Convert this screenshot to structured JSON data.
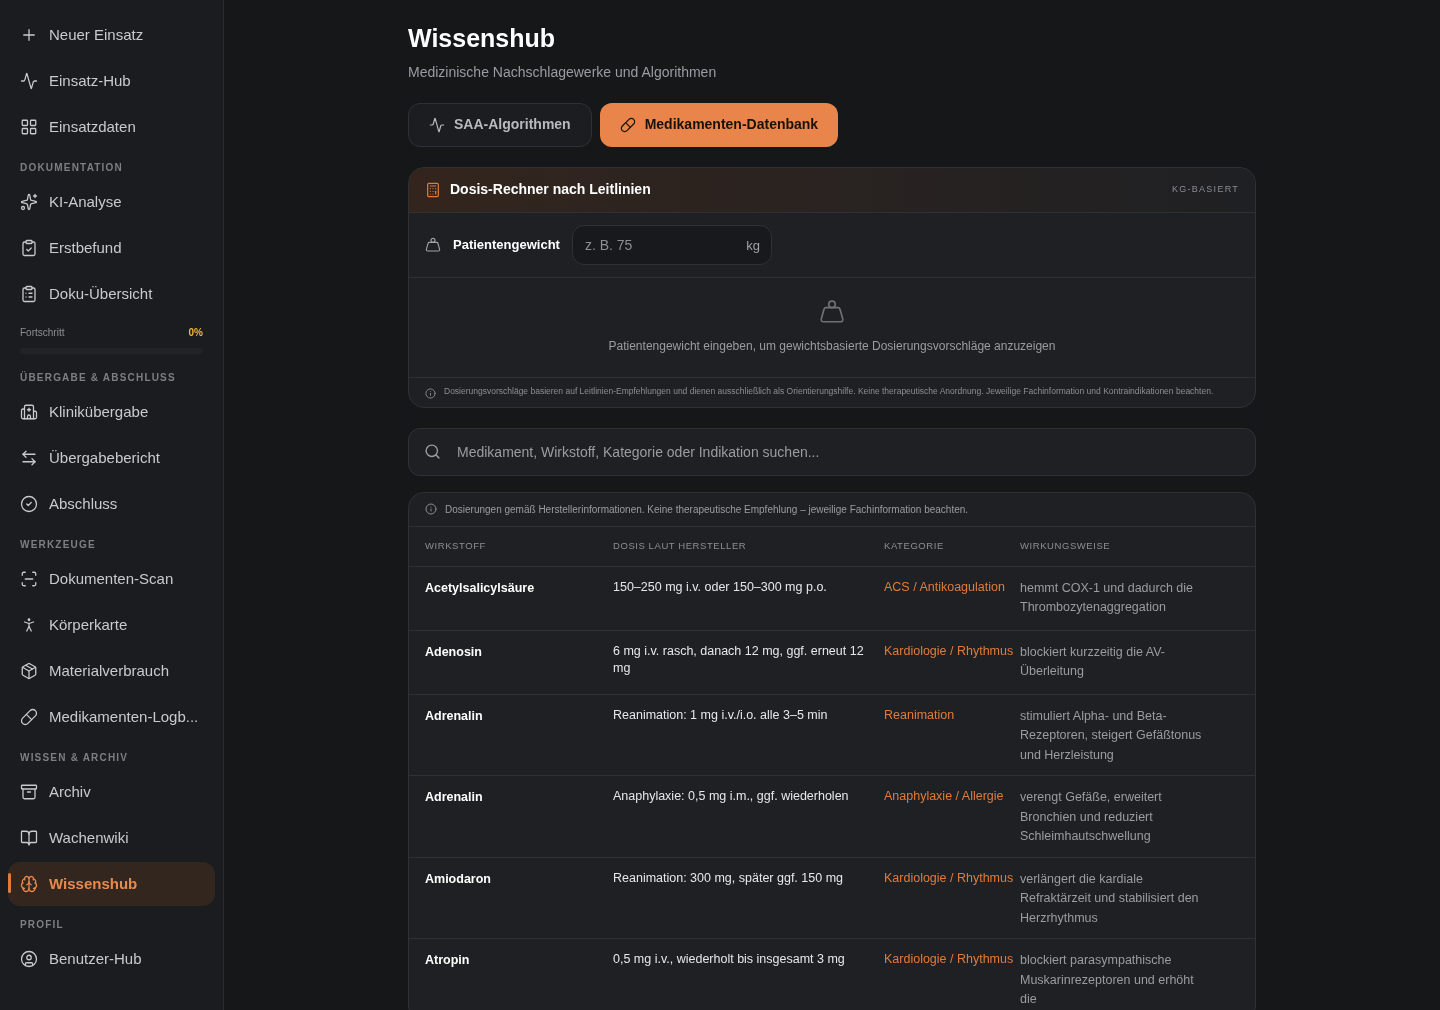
{
  "sidebar": {
    "sections": [
      {
        "items": [
          {
            "label": "Neuer Einsatz",
            "selected": false
          },
          {
            "label": "Einsatz-Hub",
            "selected": false
          },
          {
            "label": "Einsatzdaten",
            "selected": false
          }
        ]
      },
      {
        "title": "DOKUMENTATION",
        "items": [
          {
            "label": "KI-Analyse",
            "selected": false
          },
          {
            "label": "Erstbefund",
            "selected": false
          },
          {
            "label": "Doku-Übersicht",
            "selected": false
          }
        ],
        "progress": {
          "label": "Fortschritt",
          "reading": "0%",
          "level": 0
        }
      },
      {
        "title": "ÜBERGABE & ABSCHLUSS",
        "items": [
          {
            "label": "Klinikübergabe",
            "selected": false
          },
          {
            "label": "Übergabebericht",
            "selected": false
          },
          {
            "label": "Abschluss",
            "selected": false
          }
        ]
      },
      {
        "title": "WERKZEUGE",
        "items": [
          {
            "label": "Dokumenten-Scan",
            "selected": false
          },
          {
            "label": "Körperkarte",
            "selected": false
          },
          {
            "label": "Materialverbrauch",
            "selected": false
          },
          {
            "label": "Medikamenten-Logb...",
            "selected": false
          }
        ]
      },
      {
        "title": "WISSEN & ARCHIV",
        "items": [
          {
            "label": "Archiv",
            "selected": false
          },
          {
            "label": "Wachenwiki",
            "selected": false
          },
          {
            "label": "Wissenshub",
            "selected": true
          }
        ]
      },
      {
        "title": "PROFIL",
        "items": [
          {
            "label": "Benutzer-Hub",
            "selected": false
          }
        ]
      }
    ]
  },
  "page": {
    "title": "Wissenshub",
    "subtitle": "Medizinische Nachschlagewerke und Algorithmen"
  },
  "tabs": [
    {
      "label": "SAA-Algorithmen",
      "selected": false
    },
    {
      "label": "Medikamenten-Datenbank",
      "selected": true
    }
  ],
  "calculator": {
    "title": "Dosis-Rechner nach Leitlinien",
    "badge": "KG-BASIERT",
    "weight_label": "Patientengewicht",
    "weight_field": {
      "placeholder": "z. B. 75",
      "unit": "kg"
    },
    "empty_text": "Patientengewicht eingeben, um gewichtsbasierte Dosierungsvorschläge anzuzeigen",
    "disclaimer": "Dosierungsvorschläge basieren auf Leitlinien-Empfehlungen und dienen ausschließlich als Orientierungshilfe. Keine therapeutische Anordnung. Jeweilige Fachinformation und Kontraindikationen beachten."
  },
  "search": {
    "placeholder": "Medikament, Wirkstoff, Kategorie oder Indikation suchen..."
  },
  "table": {
    "notice": "Dosierungen gemäß Herstellerinformationen. Keine therapeutische Empfehlung – jeweilige Fachinformation beachten.",
    "columns": [
      "WIRKSTOFF",
      "DOSIS LAUT HERSTELLER",
      "KATEGORIE",
      "WIRKUNGSWEISE"
    ],
    "rows": [
      {
        "substance": "Acetylsalicylsäure",
        "dose": "150–250 mg i.v. oder 150–300 mg p.o.",
        "category": "ACS / Antikoagulation",
        "action": "hemmt COX-1 und dadurch die Thrombozytenaggregation"
      },
      {
        "substance": "Adenosin",
        "dose": "6 mg i.v. rasch, danach 12 mg, ggf. erneut 12 mg",
        "category": "Kardiologie / Rhythmus",
        "action": "blockiert kurzzeitig die AV-Überleitung"
      },
      {
        "substance": "Adrenalin",
        "dose": "Reanimation: 1 mg i.v./i.o. alle 3–5 min",
        "category": "Reanimation",
        "action": "stimuliert Alpha- und Beta-Rezeptoren, steigert Gefäßtonus und Herzleistung"
      },
      {
        "substance": "Adrenalin",
        "dose": "Anaphylaxie: 0,5 mg i.m., ggf. wiederholen",
        "category": "Anaphylaxie / Allergie",
        "action": "verengt Gefäße, erweitert Bronchien und reduziert Schleimhautschwellung"
      },
      {
        "substance": "Amiodaron",
        "dose": "Reanimation: 300 mg, später ggf. 150 mg",
        "category": "Kardiologie / Rhythmus",
        "action": "verlängert die kardiale Refraktärzeit und stabilisiert den Herzrhythmus"
      },
      {
        "substance": "Atropin",
        "dose": "0,5 mg i.v., wiederholt bis insgesamt 3 mg",
        "category": "Kardiologie / Rhythmus",
        "action": "blockiert parasympathische Muskarinrezeptoren und erhöht die"
      }
    ]
  }
}
